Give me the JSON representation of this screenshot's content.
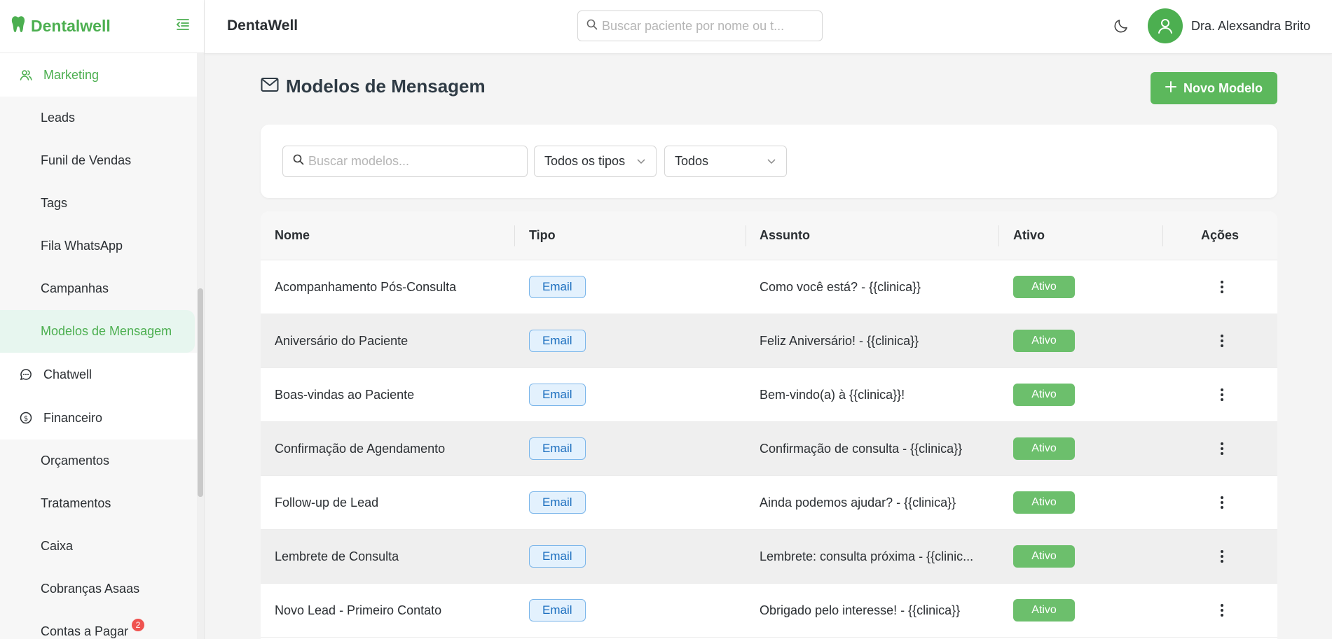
{
  "brand": {
    "name": "Dentalwell"
  },
  "sidebar": {
    "groups": [
      {
        "label": "Marketing",
        "icon": "users-icon",
        "active": true
      },
      {
        "label": "Chatwell",
        "icon": "chat-bubble-icon"
      },
      {
        "label": "Financeiro",
        "icon": "dollar-circle-icon"
      }
    ],
    "marketing_items": [
      {
        "label": "Leads"
      },
      {
        "label": "Funil de Vendas"
      },
      {
        "label": "Tags"
      },
      {
        "label": "Fila WhatsApp"
      },
      {
        "label": "Campanhas"
      },
      {
        "label": "Modelos de Mensagem",
        "selected": true
      }
    ],
    "financeiro_items": [
      {
        "label": "Orçamentos"
      },
      {
        "label": "Tratamentos"
      },
      {
        "label": "Caixa"
      },
      {
        "label": "Cobranças Asaas"
      },
      {
        "label": "Contas a Pagar",
        "badge": "2"
      }
    ]
  },
  "topbar": {
    "title": "DentaWell",
    "search_placeholder": "Buscar paciente por nome ou t...",
    "user_name": "Dra. Alexsandra Brito"
  },
  "page": {
    "title": "Modelos de Mensagem",
    "new_button": "Novo Modelo"
  },
  "filters": {
    "search_placeholder": "Buscar modelos...",
    "type_select": "Todos os tipos",
    "status_select": "Todos"
  },
  "table": {
    "columns": [
      "Nome",
      "Tipo",
      "Assunto",
      "Ativo",
      "Ações"
    ],
    "rows": [
      {
        "nome": "Acompanhamento Pós-Consulta",
        "tipo": "Email",
        "assunto": "Como você está? - {{clinica}}",
        "ativo": "Ativo"
      },
      {
        "nome": "Aniversário do Paciente",
        "tipo": "Email",
        "assunto": "Feliz Aniversário! - {{clinica}}",
        "ativo": "Ativo"
      },
      {
        "nome": "Boas-vindas ao Paciente",
        "tipo": "Email",
        "assunto": "Bem-vindo(a) à {{clinica}}!",
        "ativo": "Ativo"
      },
      {
        "nome": "Confirmação de Agendamento",
        "tipo": "Email",
        "assunto": "Confirmação de consulta - {{clinica}}",
        "ativo": "Ativo"
      },
      {
        "nome": "Follow-up de Lead",
        "tipo": "Email",
        "assunto": "Ainda podemos ajudar? - {{clinica}}",
        "ativo": "Ativo"
      },
      {
        "nome": "Lembrete de Consulta",
        "tipo": "Email",
        "assunto": "Lembrete: consulta próxima - {{clinic...",
        "ativo": "Ativo"
      },
      {
        "nome": "Novo Lead - Primeiro Contato",
        "tipo": "Email",
        "assunto": "Obrigado pelo interesse! - {{clinica}}",
        "ativo": "Ativo"
      }
    ]
  },
  "colors": {
    "brand_green": "#4caf50",
    "active_chip": "#6cbf6c",
    "email_chip_border": "#7bb6ea"
  }
}
